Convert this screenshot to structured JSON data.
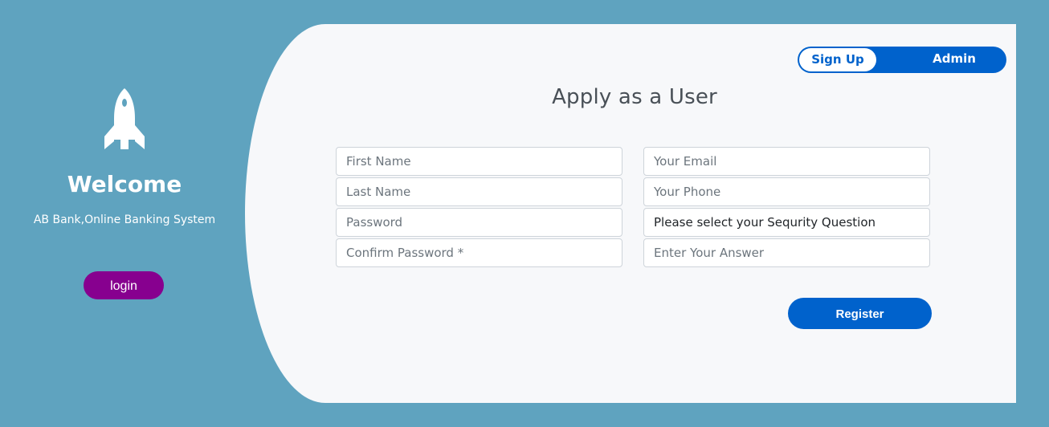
{
  "sidebar": {
    "icon": "rocket-icon",
    "welcome": "Welcome",
    "tagline": "AB Bank,Online Banking System",
    "login_label": "login"
  },
  "toggle": {
    "signup_label": "Sign Up",
    "admin_label": "Admin",
    "active": "Sign Up"
  },
  "form": {
    "title": "Apply as a User",
    "left_fields": {
      "first_name": "First Name",
      "last_name": "Last Name",
      "password": "Password",
      "confirm_password": "Confirm Password *"
    },
    "right_fields": {
      "email": "Your Email",
      "phone": "Your Phone",
      "security_question": "Please select your Sequrity Question",
      "answer": "Enter Your Answer"
    },
    "register_label": "Register"
  },
  "colors": {
    "background": "#5fa3bf",
    "card": "#f7f8fa",
    "primary": "#0062cc",
    "login": "#87008f"
  }
}
